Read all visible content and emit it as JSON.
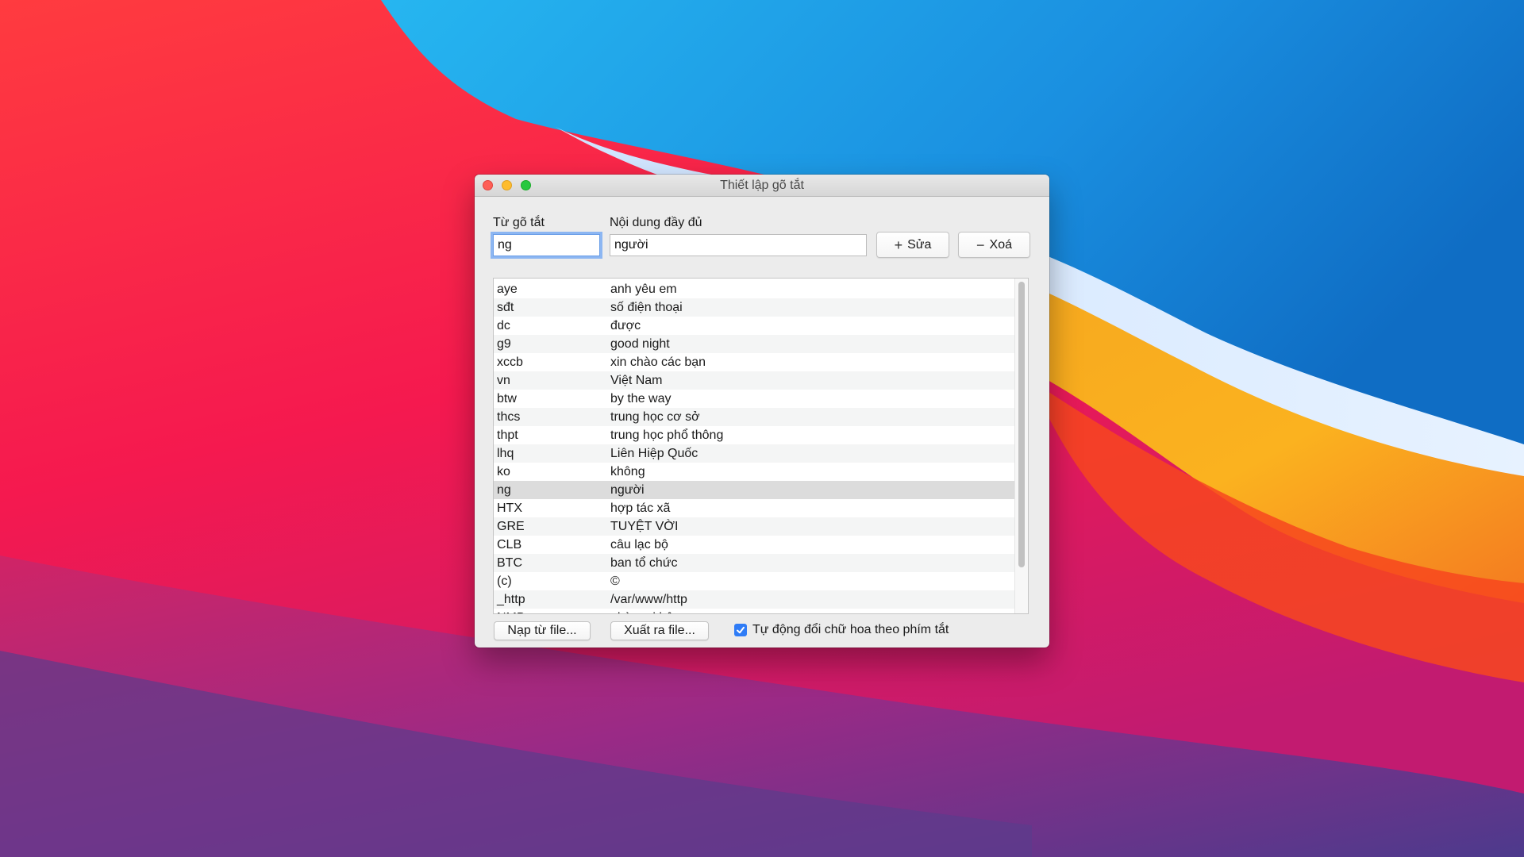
{
  "window": {
    "title": "Thiết lập gõ tắt"
  },
  "form": {
    "shortcut_label": "Từ gõ tắt",
    "content_label": "Nội dung đầy đủ",
    "shortcut_value": "ng",
    "content_value": "người",
    "edit_button": "Sửa",
    "delete_button": "Xoá"
  },
  "table": {
    "rows": [
      {
        "shortcut": "aye",
        "content": "anh yêu em"
      },
      {
        "shortcut": "sđt",
        "content": "số điện thoại"
      },
      {
        "shortcut": "dc",
        "content": "được"
      },
      {
        "shortcut": "g9",
        "content": "good night"
      },
      {
        "shortcut": "xccb",
        "content": "xin chào các bạn"
      },
      {
        "shortcut": "vn",
        "content": "Việt Nam"
      },
      {
        "shortcut": "btw",
        "content": "by the way"
      },
      {
        "shortcut": "thcs",
        "content": "trung học cơ sở"
      },
      {
        "shortcut": "thpt",
        "content": "trung học phổ thông"
      },
      {
        "shortcut": "lhq",
        "content": "Liên Hiệp Quốc"
      },
      {
        "shortcut": "ko",
        "content": "không"
      },
      {
        "shortcut": "ng",
        "content": "người"
      },
      {
        "shortcut": "HTX",
        "content": "hợp tác xã"
      },
      {
        "shortcut": "GRE",
        "content": "TUYỆT VỜI"
      },
      {
        "shortcut": "CLB",
        "content": "câu lạc bộ"
      },
      {
        "shortcut": "BTC",
        "content": "ban tổ chức"
      },
      {
        "shortcut": "(c)",
        "content": "©"
      },
      {
        "shortcut": "_http",
        "content": "/var/www/http"
      },
      {
        "shortcut": "NMB",
        "content": "nhà mọi bộ"
      }
    ],
    "selected_shortcut": "ng"
  },
  "footer": {
    "import_button": "Nạp từ file...",
    "export_button": "Xuất ra file...",
    "auto_caps_label": "Tự động đổi chữ hoa theo phím tắt",
    "auto_caps_checked": true
  },
  "colors": {
    "accent": "#2f7cf6",
    "selection": "#dcdcdc"
  },
  "icons": {
    "edit": "plus-icon",
    "delete": "minus-icon",
    "checkbox": "checkmark-icon"
  }
}
